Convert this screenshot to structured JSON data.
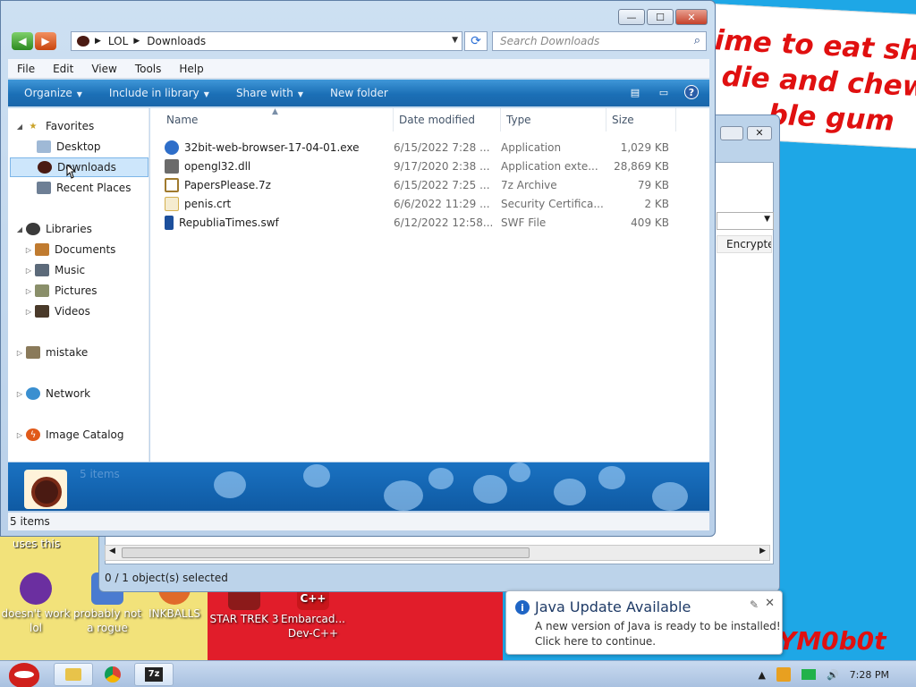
{
  "window": {
    "address_crumbs": [
      "LOL",
      "Downloads"
    ],
    "search_placeholder": "Search Downloads"
  },
  "menu": [
    "File",
    "Edit",
    "View",
    "Tools",
    "Help"
  ],
  "commands": {
    "organize": "Organize",
    "include": "Include in library",
    "share": "Share with",
    "new_folder": "New folder"
  },
  "nav": {
    "favorites": "Favorites",
    "desktop": "Desktop",
    "downloads": "Downloads",
    "recent": "Recent Places",
    "libraries": "Libraries",
    "documents": "Documents",
    "music": "Music",
    "pictures": "Pictures",
    "videos": "Videos",
    "mistake": "mistake",
    "network": "Network",
    "image_catalog": "Image Catalog"
  },
  "columns": {
    "name": "Name",
    "date": "Date modified",
    "type": "Type",
    "size": "Size"
  },
  "files": [
    {
      "name": "32bit-web-browser-17-04-01.exe",
      "date": "6/15/2022 7:28 ...",
      "type": "Application",
      "size": "1,029 KB",
      "icon_color": "#2e6ec9"
    },
    {
      "name": "opengl32.dll",
      "date": "9/17/2020 2:38 ...",
      "type": "Application exte...",
      "size": "28,869 KB",
      "icon_color": "#6b6b6b"
    },
    {
      "name": "PapersPlease.7z",
      "date": "6/15/2022 7:25 ...",
      "type": "7z Archive",
      "size": "79 KB",
      "icon_color": "#a07a2e"
    },
    {
      "name": "penis.crt",
      "date": "6/6/2022 11:29 ...",
      "type": "Security Certifica...",
      "size": "2 KB",
      "icon_color": "#d4b050"
    },
    {
      "name": "RepubliaTimes.swf",
      "date": "6/12/2022 12:58...",
      "type": "SWF File",
      "size": "409 KB",
      "icon_color": "#1c4f9c"
    }
  ],
  "details_text": "5 items",
  "status_text": "5 items",
  "back_window": {
    "column": "Encrypte",
    "status": "0 / 1 object(s) selected"
  },
  "wall_sign": [
    "ime to eat shit",
    "die and chew",
    "ble gum"
  ],
  "corner_text": "YM0b0t",
  "uses_this": "uses this",
  "desktop_icons": [
    {
      "label": "doesn't work lol",
      "color": "#6b2fa0"
    },
    {
      "label": "probably not a rogue",
      "color": "#4a7bd0"
    },
    {
      "label": "INKBALLS",
      "color": "#e06a2a"
    },
    {
      "label": "STAR TREK 3",
      "color": "#8c1a1a"
    },
    {
      "label": "Embarcad... Dev-C++",
      "color": "#c8161b"
    }
  ],
  "toast": {
    "title": "Java Update Available",
    "body": "A new version of Java is ready to be installed! Click here to continue."
  },
  "clock": "7:28 PM"
}
